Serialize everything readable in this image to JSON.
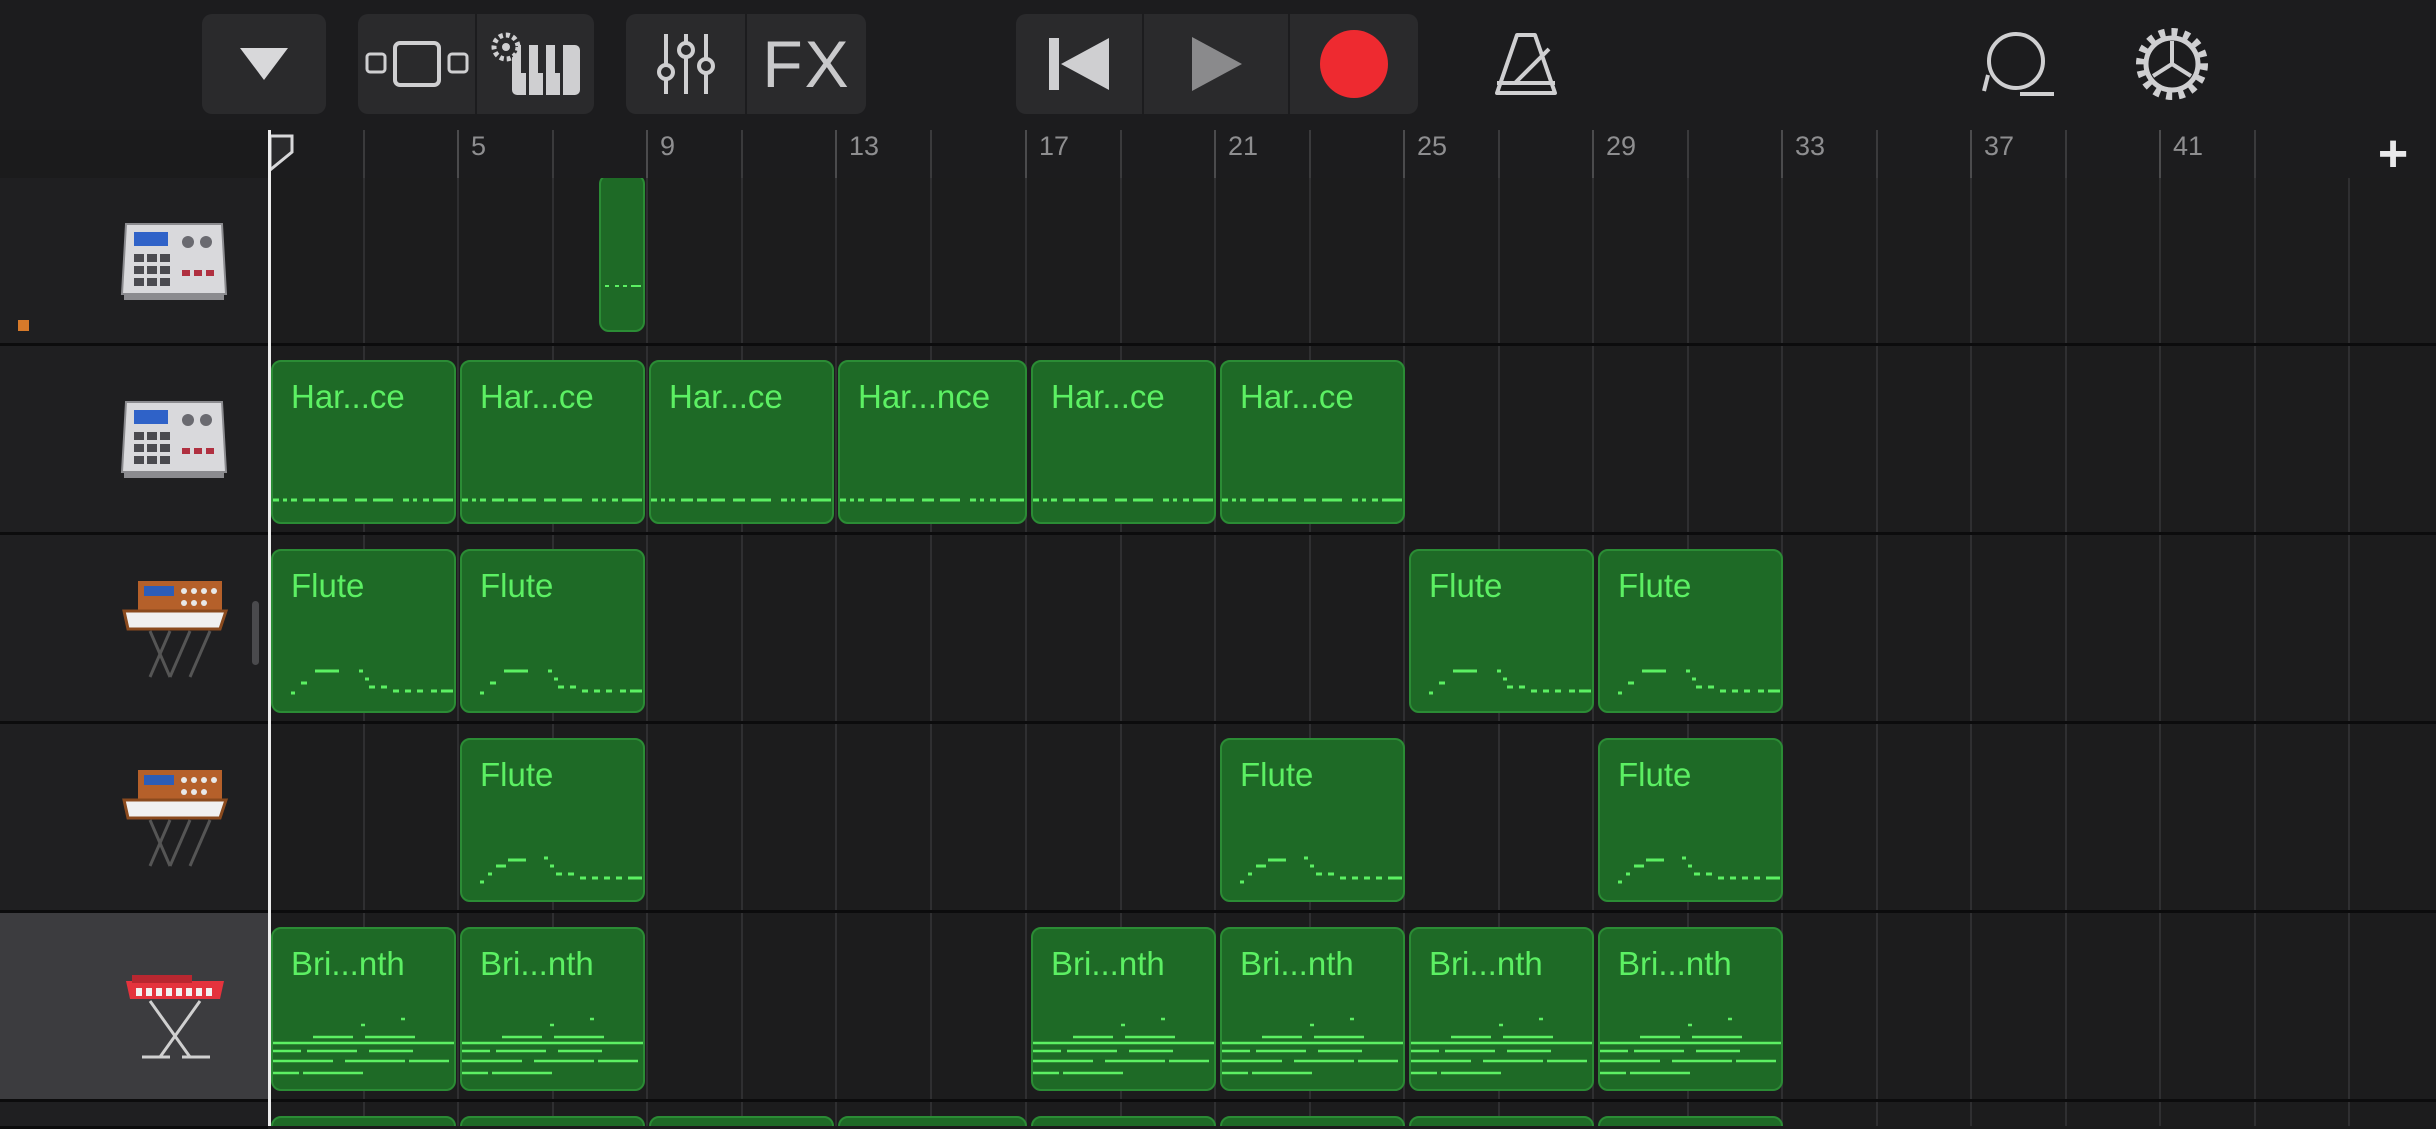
{
  "toolbar": {
    "fx_label": "FX",
    "icons": [
      "dropdown-triangle-icon",
      "tracks-view-icon",
      "instrument-settings-icon",
      "mixer-icon",
      "skip-back-icon",
      "play-icon",
      "record-icon",
      "metronome-icon",
      "loop-icon",
      "settings-gear-icon"
    ],
    "record_color": "#ee2a30"
  },
  "ruler": {
    "bars": [
      "5",
      "9",
      "13",
      "17",
      "21",
      "25",
      "29",
      "33",
      "37",
      "41"
    ],
    "add_label": "+"
  },
  "colors": {
    "region_fill": "#1e6a26",
    "region_text": "#5cf063",
    "accent_marker": "#d77a2a"
  },
  "tracks": [
    {
      "name": "drum-machine",
      "instrument": "drum-machine-icon",
      "regions": [
        {
          "label": ""
        }
      ]
    },
    {
      "name": "beat-sequencer",
      "instrument": "drum-machine-icon",
      "regions": [
        {
          "label": "Har...ce"
        },
        {
          "label": "Har...ce"
        },
        {
          "label": "Har...ce"
        },
        {
          "label": "Har...nce"
        },
        {
          "label": "Har...ce"
        },
        {
          "label": "Har...ce"
        }
      ]
    },
    {
      "name": "flute-track-1",
      "instrument": "vintage-synth-icon",
      "regions": [
        {
          "label": "Flute"
        },
        {
          "label": "Flute"
        },
        {
          "label": "Flute"
        },
        {
          "label": "Flute"
        }
      ]
    },
    {
      "name": "flute-track-2",
      "instrument": "vintage-synth-icon",
      "regions": [
        {
          "label": "Flute"
        },
        {
          "label": "Flute"
        },
        {
          "label": "Flute"
        }
      ]
    },
    {
      "name": "synth-track",
      "instrument": "red-keyboard-icon",
      "selected": true,
      "regions": [
        {
          "label": "Bri...nth"
        },
        {
          "label": "Bri...nth"
        },
        {
          "label": "Bri...nth"
        },
        {
          "label": "Bri...nth"
        },
        {
          "label": "Bri...nth"
        },
        {
          "label": "Bri...nth"
        }
      ]
    }
  ]
}
